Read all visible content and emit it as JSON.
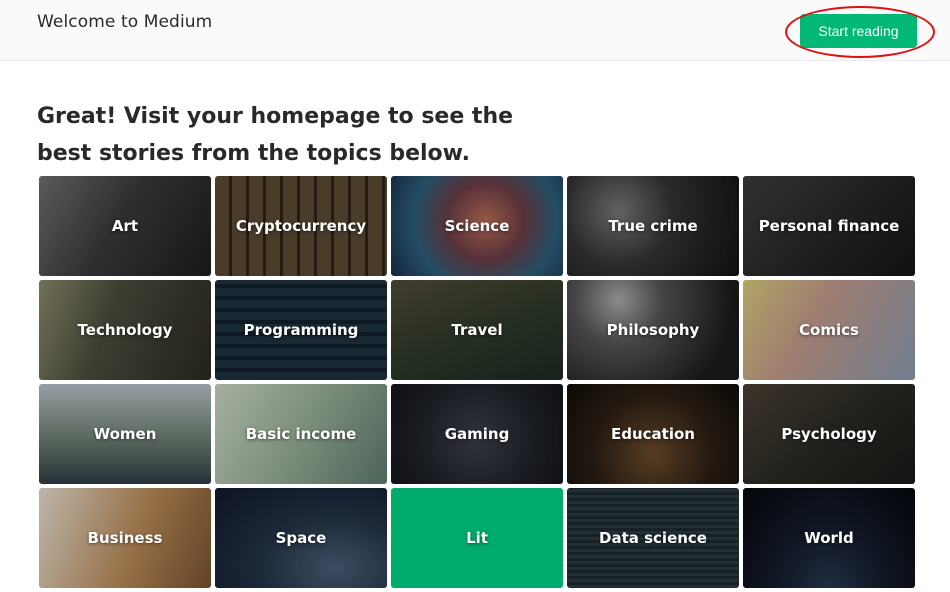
{
  "header": {
    "brand": "Welcome to Medium",
    "start_button": "Start reading"
  },
  "main": {
    "headline": "Great! Visit your homepage to see the best stories from the topics below."
  },
  "colors": {
    "accent": "#02b875",
    "annotation": "#e01010"
  },
  "topics": [
    {
      "label": "Art"
    },
    {
      "label": "Cryptocurrency"
    },
    {
      "label": "Science"
    },
    {
      "label": "True crime"
    },
    {
      "label": "Personal finance"
    },
    {
      "label": "Technology"
    },
    {
      "label": "Programming"
    },
    {
      "label": "Travel"
    },
    {
      "label": "Philosophy"
    },
    {
      "label": "Comics"
    },
    {
      "label": "Women"
    },
    {
      "label": "Basic income"
    },
    {
      "label": "Gaming"
    },
    {
      "label": "Education"
    },
    {
      "label": "Psychology"
    },
    {
      "label": "Business"
    },
    {
      "label": "Space"
    },
    {
      "label": "Lit"
    },
    {
      "label": "Data science"
    },
    {
      "label": "World"
    }
  ]
}
